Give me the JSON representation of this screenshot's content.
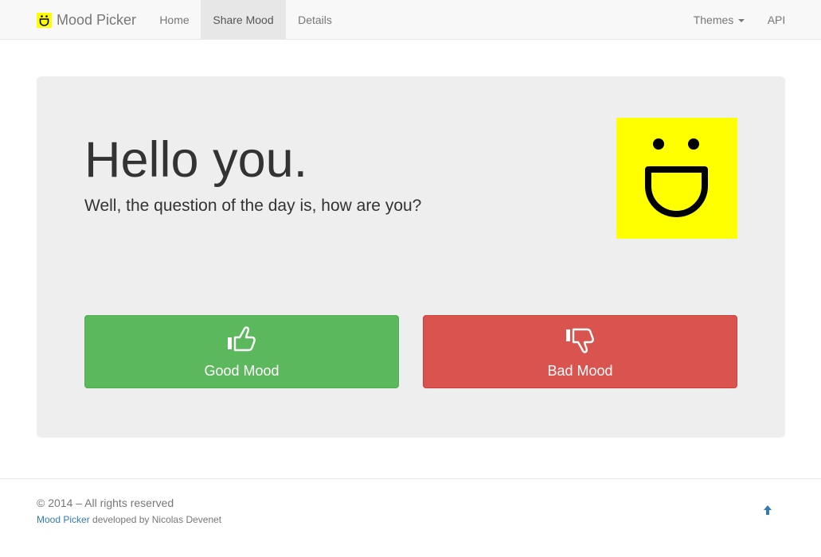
{
  "navbar": {
    "brand": "Mood Picker",
    "items": [
      {
        "label": "Home"
      },
      {
        "label": "Share Mood",
        "active": true
      },
      {
        "label": "Details"
      }
    ],
    "right_items": [
      {
        "label": "Themes",
        "dropdown": true
      },
      {
        "label": "API"
      }
    ]
  },
  "hero": {
    "title": "Hello you.",
    "subtitle": "Well, the question of the day is, how are you?",
    "smiley_icon": "smiley-face-icon",
    "smiley_bg": "#ffff00"
  },
  "buttons": {
    "good": {
      "label": "Good Mood",
      "icon": "thumbs-up-icon",
      "color": "#5cb85c"
    },
    "bad": {
      "label": "Bad Mood",
      "icon": "thumbs-down-icon",
      "color": "#d9534f"
    }
  },
  "footer": {
    "copyright": "© 2014 – All rights reserved",
    "app_link": "Mood Picker",
    "credit_text": " developed by Nicolas Devenet",
    "top_icon": "arrow-up-icon"
  },
  "colors": {
    "accent_link": "#337ab7",
    "jumbotron_bg": "#eeeeee"
  }
}
